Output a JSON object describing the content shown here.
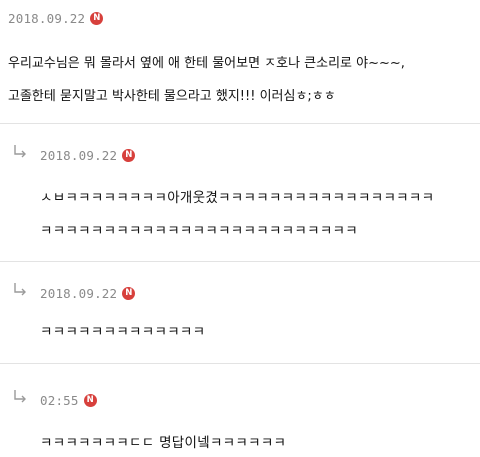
{
  "comments": [
    {
      "date": "2018.09.22",
      "badge": "N",
      "lines": [
        "우리교수님은 뭐 몰라서 옆에 애 한테 물어보면 ㅈ호나 큰소리로 야~~~,",
        "고졸한테 묻지말고 박사한테 물으라고 했지!!! 이러심ㅎ;ㅎㅎ"
      ]
    },
    {
      "date": "2018.09.22",
      "badge": "N",
      "lines": [
        "ㅅㅂㅋㅋㅋㅋㅋㅋㅋㅋ아개웃겼ㅋㅋㅋㅋㅋㅋㅋㅋㅋㅋㅋㅋㅋㅋㅋㅋㅋ",
        "ㅋㅋㅋㅋㅋㅋㅋㅋㅋㅋㅋㅋㅋㅋㅋㅋㅋㅋㅋㅋㅋㅋㅋㅋㅋ"
      ]
    },
    {
      "date": "2018.09.22",
      "badge": "N",
      "lines": [
        "ㅋㅋㅋㅋㅋㅋㅋㅋㅋㅋㅋㅋㅋ"
      ]
    },
    {
      "date": "02:55",
      "badge": "N",
      "lines": [
        "ㅋㅋㅋㅋㅋㅋㅋㄷㄷ 명답이넼ㅋㅋㅋㅋㅋㅋ"
      ]
    }
  ]
}
